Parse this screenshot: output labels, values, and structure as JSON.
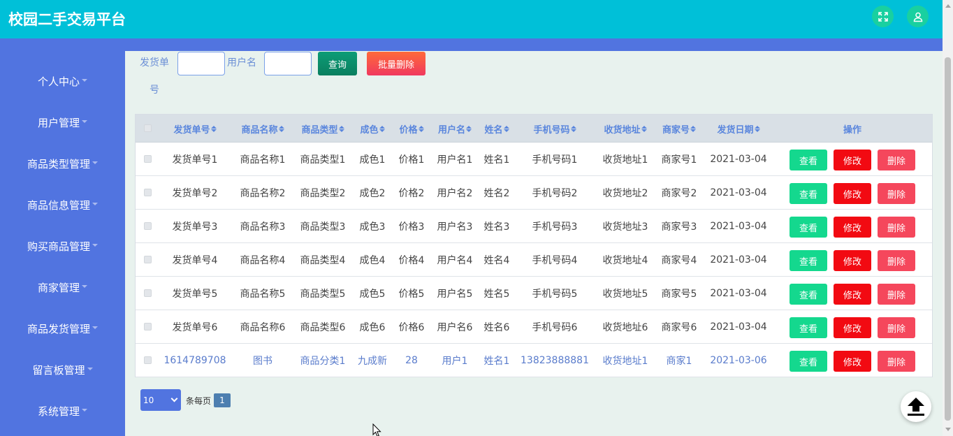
{
  "header": {
    "title": "校园二手交易平台",
    "fullscreen_icon": "expand-icon",
    "user_icon": "user-icon"
  },
  "sidebar": {
    "items": [
      {
        "label": "个人中心"
      },
      {
        "label": "用户管理"
      },
      {
        "label": "商品类型管理"
      },
      {
        "label": "商品信息管理"
      },
      {
        "label": "购买商品管理"
      },
      {
        "label": "商家管理"
      },
      {
        "label": "商品发货管理"
      },
      {
        "label": "留言板管理"
      },
      {
        "label": "系统管理"
      }
    ]
  },
  "search": {
    "order_label_line1": "发货单",
    "order_label_line2": "号",
    "order_value": "",
    "username_label": "用户名",
    "username_value": "",
    "query_button": "查询",
    "batch_delete_button": "批量删除"
  },
  "table": {
    "headers": [
      "发货单号",
      "商品名称",
      "商品类型",
      "成色",
      "价格",
      "用户名",
      "姓名",
      "手机号码",
      "收货地址",
      "商家号",
      "发货日期",
      "操作"
    ],
    "actions": {
      "view": "查看",
      "edit": "修改",
      "delete": "删除"
    },
    "rows": [
      [
        "发货单号1",
        "商品名称1",
        "商品类型1",
        "成色1",
        "价格1",
        "用户名1",
        "姓名1",
        "手机号码1",
        "收货地址1",
        "商家号1",
        "2021-03-04"
      ],
      [
        "发货单号2",
        "商品名称2",
        "商品类型2",
        "成色2",
        "价格2",
        "用户名2",
        "姓名2",
        "手机号码2",
        "收货地址2",
        "商家号2",
        "2021-03-04"
      ],
      [
        "发货单号3",
        "商品名称3",
        "商品类型3",
        "成色3",
        "价格3",
        "用户名3",
        "姓名3",
        "手机号码3",
        "收货地址3",
        "商家号3",
        "2021-03-04"
      ],
      [
        "发货单号4",
        "商品名称4",
        "商品类型4",
        "成色4",
        "价格4",
        "用户名4",
        "姓名4",
        "手机号码4",
        "收货地址4",
        "商家号4",
        "2021-03-04"
      ],
      [
        "发货单号5",
        "商品名称5",
        "商品类型5",
        "成色5",
        "价格5",
        "用户名5",
        "姓名5",
        "手机号码5",
        "收货地址5",
        "商家号5",
        "2021-03-04"
      ],
      [
        "发货单号6",
        "商品名称6",
        "商品类型6",
        "成色6",
        "价格6",
        "用户名6",
        "姓名6",
        "手机号码6",
        "收货地址6",
        "商家号6",
        "2021-03-04"
      ],
      [
        "1614789708",
        "图书",
        "商品分类1",
        "九成新",
        "28",
        "用户1",
        "姓名1",
        "13823888881",
        "收货地址1",
        "商家1",
        "2021-03-06"
      ]
    ]
  },
  "pager": {
    "page_size": "10",
    "per_page_label": "条每页",
    "current_page": "1"
  },
  "back_to_top_icon": "arrow-up-icon",
  "colors": {
    "header": "#00c0d8",
    "sidebar": "#5174e0",
    "content_bg": "#e8f2ee",
    "view_button": "#14d88e",
    "edit_button": "#f20a12",
    "delete_button": "#f5475c"
  }
}
